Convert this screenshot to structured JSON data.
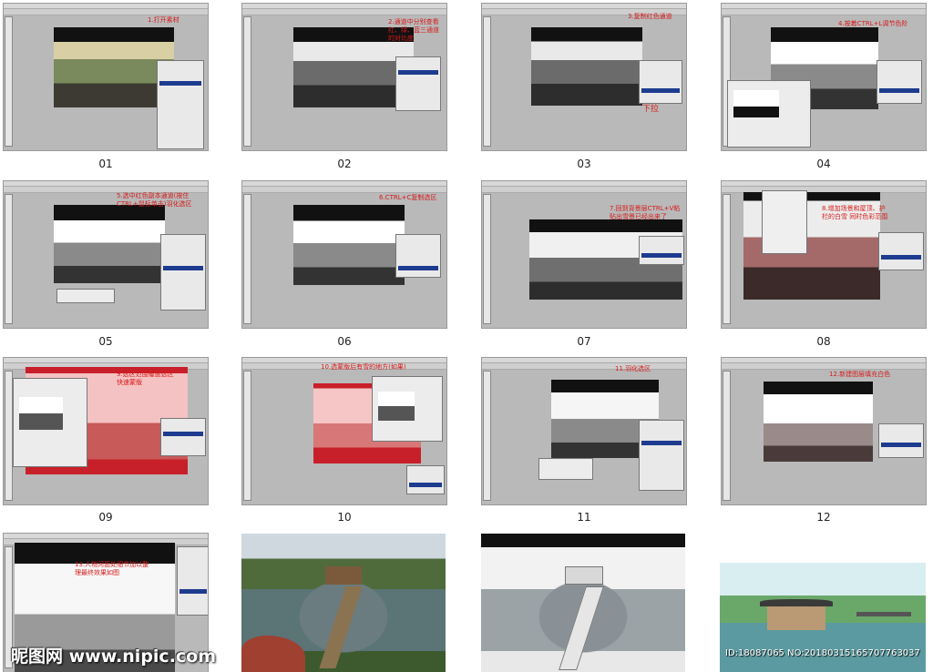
{
  "steps": [
    {
      "caption": "01",
      "note": "1.打开素材"
    },
    {
      "caption": "02",
      "note": "2.通道中分别查看红、绿、蓝三通道的对比度"
    },
    {
      "caption": "03",
      "note": "3.复制红色通道"
    },
    {
      "caption": "04",
      "note": "4.按着CTRL+L调节色阶"
    },
    {
      "caption": "05",
      "note": "5.选中红色副本通道(按住CTRL+鼠标单击)羽化选区"
    },
    {
      "caption": "06",
      "note": "6.CTRL+C复制选区"
    },
    {
      "caption": "07",
      "note": "7.回到背景层CTRL+V粘贴出雪景已经出来了"
    },
    {
      "caption": "08",
      "note": "8.增加场景和屋顶、护栏的白雪 同时色彩范围"
    },
    {
      "caption": "09",
      "note": "9.选区范围覆盖选区 快速蒙版"
    },
    {
      "caption": "10",
      "note": "10.选蒙版后有雪的地方(如果)"
    },
    {
      "caption": "11",
      "note": "11.羽化选区"
    },
    {
      "caption": "12",
      "note": "12.新建图层填充白色"
    },
    {
      "note": "13.人物河面处细节加以整理最终效果如图"
    }
  ],
  "arrow_note": "下拉",
  "watermark": {
    "logo": "昵图网 www.nipic.com",
    "id": "ID:18087065 NO:20180315165707763037"
  },
  "colors": {
    "annotation": "#d61a1a",
    "layer_selected": "#1d3b8f"
  }
}
